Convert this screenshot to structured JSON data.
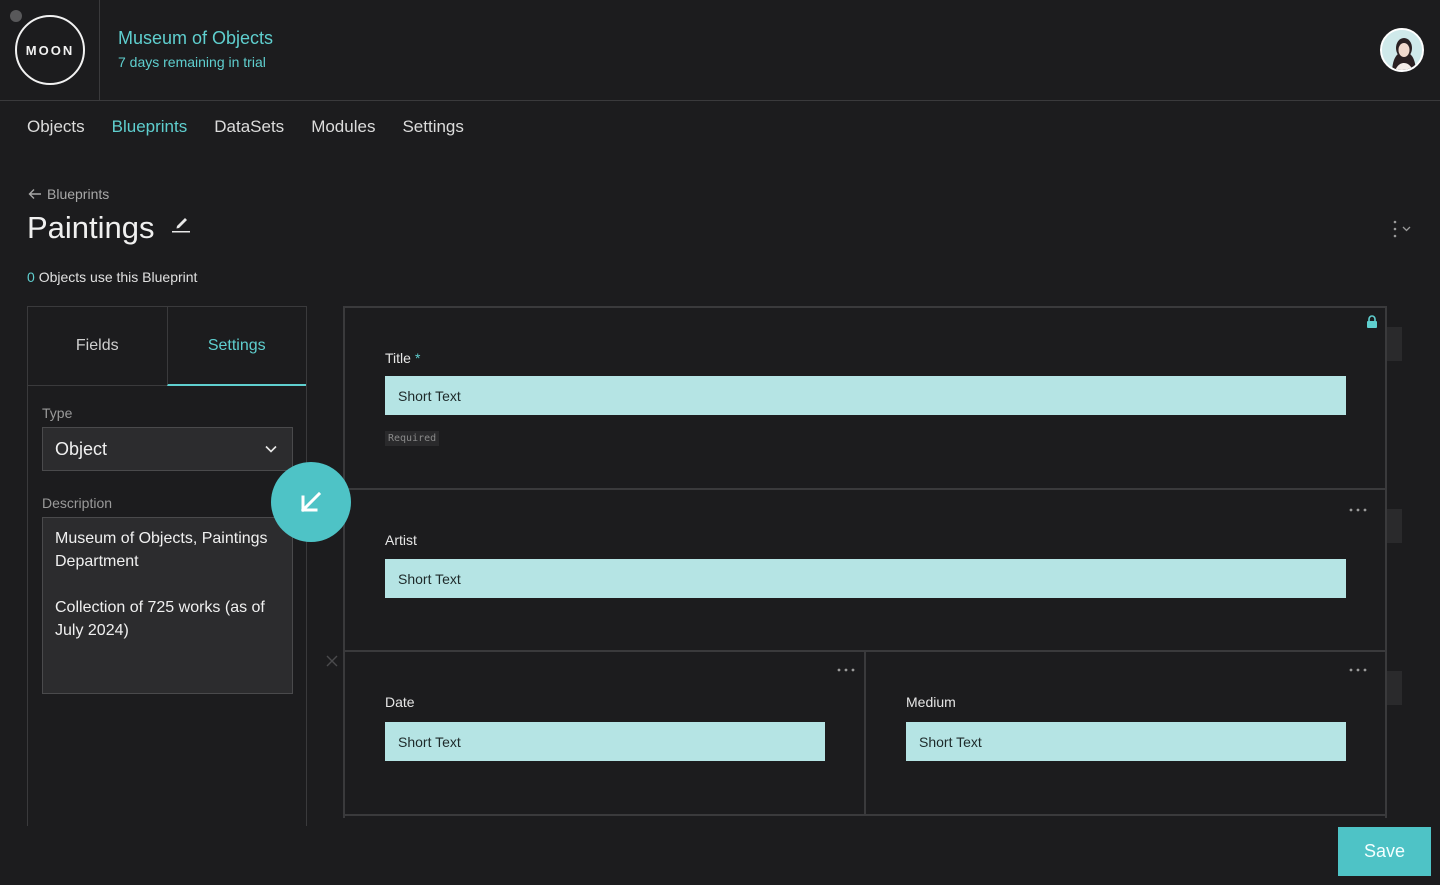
{
  "header": {
    "logo_text": "MOON",
    "org_name": "Museum of Objects",
    "trial_text": "7 days remaining in trial"
  },
  "nav": {
    "items": [
      {
        "label": "Objects",
        "active": false
      },
      {
        "label": "Blueprints",
        "active": true
      },
      {
        "label": "DataSets",
        "active": false
      },
      {
        "label": "Modules",
        "active": false
      },
      {
        "label": "Settings",
        "active": false
      }
    ]
  },
  "page": {
    "back_label": "Blueprints",
    "title": "Paintings",
    "usage_count": "0",
    "usage_text": "Objects use this Blueprint"
  },
  "side_panel": {
    "tabs": [
      {
        "label": "Fields",
        "active": false
      },
      {
        "label": "Settings",
        "active": true
      }
    ],
    "type_label": "Type",
    "type_value": "Object",
    "description_label": "Description",
    "description_value": "Museum of Objects, Paintings Department\n\nCollection of 725 works (as of July 2024)"
  },
  "fields": {
    "title": {
      "label": "Title",
      "required_mark": "*",
      "type": "Short Text",
      "badge": "Required"
    },
    "artist": {
      "label": "Artist",
      "type": "Short Text"
    },
    "date": {
      "label": "Date",
      "type": "Short Text"
    },
    "medium": {
      "label": "Medium",
      "type": "Short Text"
    }
  },
  "actions": {
    "save_label": "Save"
  },
  "colors": {
    "accent": "#5fcfcf",
    "field_fill": "#b5e4e4",
    "background": "#1c1c1e",
    "button": "#4ec3c6"
  }
}
